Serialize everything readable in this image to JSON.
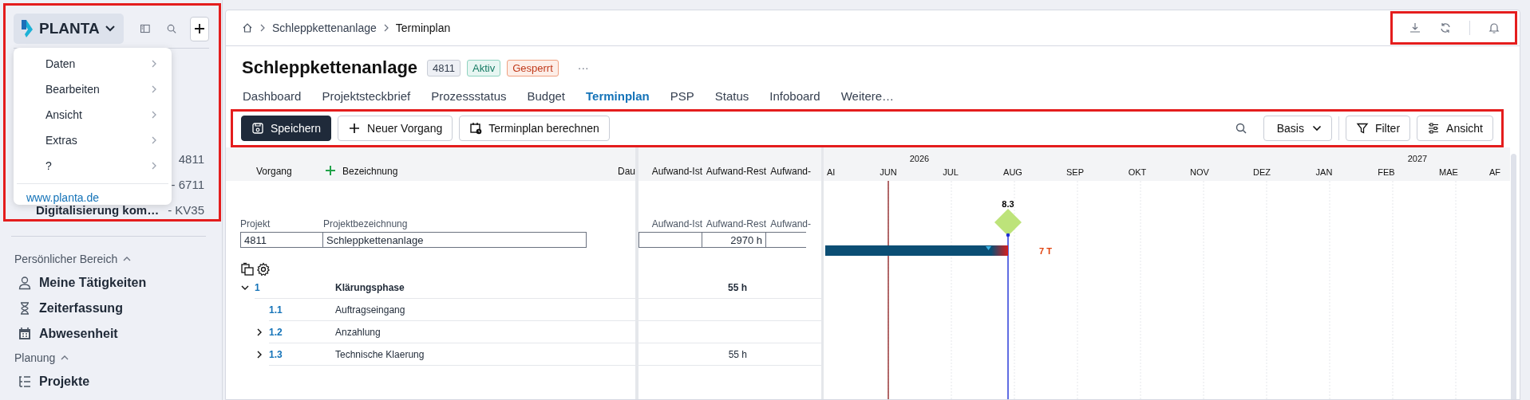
{
  "sidebar": {
    "brand": "PLANTA",
    "app_menu": {
      "items": [
        {
          "label": "Daten"
        },
        {
          "label": "Bearbeiten"
        },
        {
          "label": "Ansicht"
        },
        {
          "label": "Extras"
        },
        {
          "label": "?"
        }
      ],
      "link": "www.planta.de"
    },
    "recent_items": [
      {
        "code": "4811"
      },
      {
        "code": "- 6711"
      },
      {
        "name": "Digitalisierung kom…",
        "code": "- KV35"
      }
    ],
    "sections": [
      {
        "title": "Persönlicher Bereich",
        "expanded": true,
        "items": [
          {
            "label": "Meine Tätigkeiten",
            "kind": "person"
          },
          {
            "label": "Zeiterfassung",
            "kind": "hourglass"
          },
          {
            "label": "Abwesenheit",
            "kind": "calendar"
          }
        ]
      },
      {
        "title": "Planung",
        "expanded": true,
        "items": [
          {
            "label": "Projekte",
            "kind": "list"
          }
        ]
      }
    ]
  },
  "breadcrumb": [
    "Schleppkettenanlage",
    "Terminplan"
  ],
  "project": {
    "title": "Schleppkettenanlage",
    "badges": [
      {
        "label": "4811",
        "kind": "neutral"
      },
      {
        "label": "Aktiv",
        "kind": "success"
      },
      {
        "label": "Gesperrt",
        "kind": "danger"
      }
    ],
    "more": "···"
  },
  "tabs": [
    {
      "label": "Dashboard",
      "selected": false
    },
    {
      "label": "Projektsteckbrief",
      "selected": false
    },
    {
      "label": "Prozessstatus",
      "selected": false
    },
    {
      "label": "Budget",
      "selected": false
    },
    {
      "label": "Terminplan",
      "selected": true
    },
    {
      "label": "PSP",
      "selected": false
    },
    {
      "label": "Status",
      "selected": false
    },
    {
      "label": "Infoboard",
      "selected": false
    },
    {
      "label": "Weitere…",
      "selected": false
    }
  ],
  "toolbar": {
    "actions": [
      {
        "label": "Speichern",
        "kind": "primary"
      },
      {
        "label": "Neuer Vorgang",
        "kind": "add"
      },
      {
        "label": "Terminplan berechnen",
        "kind": "calculate"
      }
    ],
    "view": "Basis",
    "options": [
      {
        "label": "Filter",
        "kind": "filter"
      },
      {
        "label": "Ansicht",
        "kind": "settings"
      }
    ]
  },
  "table": {
    "columns": [
      "Vorgang",
      "Bezeichnung",
      "Dau"
    ],
    "effort_columns": [
      "Aufwand-Ist",
      "Aufwand-Rest",
      "Aufwand-"
    ],
    "project_labels": [
      "Projekt",
      "Projektbezeichnung"
    ],
    "effort_labels": [
      "Aufwand-Ist",
      "Aufwand-Rest",
      "Aufwand-"
    ],
    "project_row": {
      "id": "4811",
      "name": "Schleppkettenanlage",
      "effort_rest": "2970 h"
    },
    "rows": [
      {
        "number": "1",
        "name": "Klärungsphase",
        "effort_rest": "55 h",
        "expanded": true,
        "children": [
          {
            "number": "1.1",
            "name": "Auftragseingang"
          },
          {
            "number": "1.2",
            "name": "Anzahlung",
            "expanded": false
          },
          {
            "number": "1.3",
            "name": "Technische Klaerung",
            "effort_rest": "55 h",
            "expanded": false
          }
        ]
      }
    ]
  },
  "gantt": {
    "years": [
      "2026",
      "2027"
    ],
    "months": [
      "AI",
      "JUN",
      "JUL",
      "AUG",
      "SEP",
      "OKT",
      "NOV",
      "DEZ",
      "JAN",
      "FEB",
      "MAE",
      "AF"
    ],
    "milestone": "8.3",
    "delay": "7 T"
  }
}
